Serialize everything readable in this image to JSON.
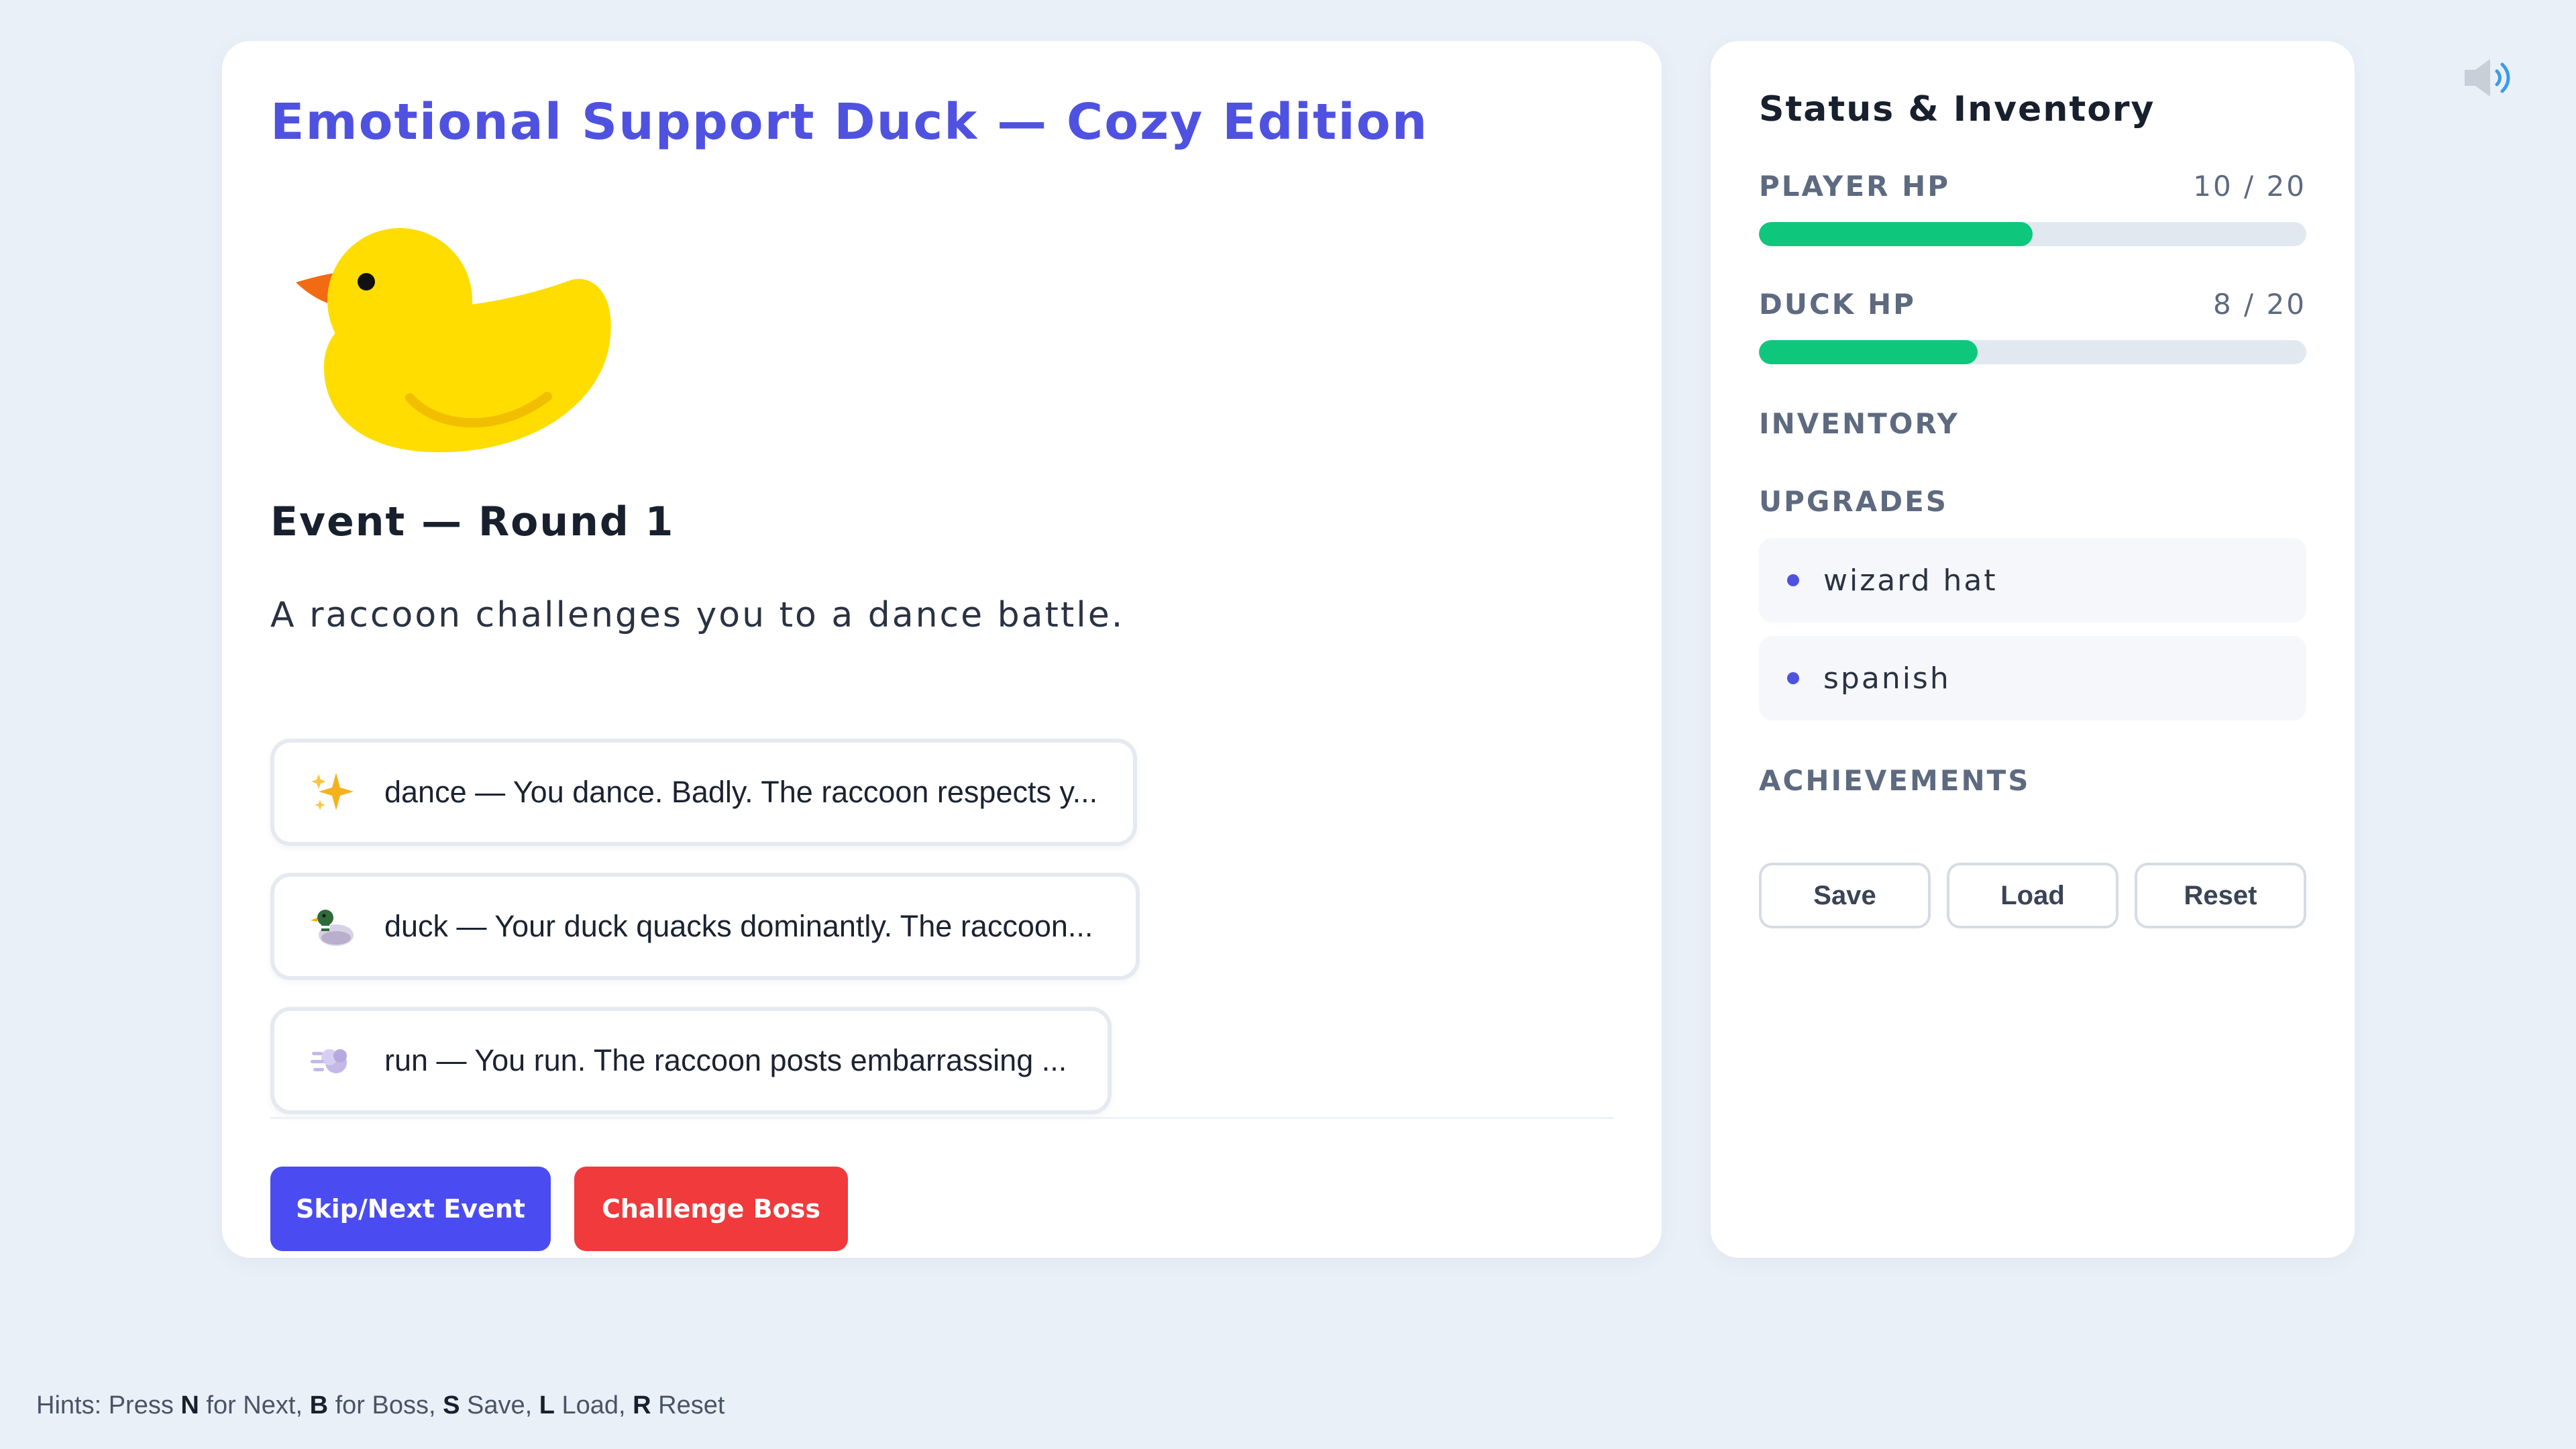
{
  "game": {
    "title": "Emotional Support Duck — Cozy Edition"
  },
  "event": {
    "heading": "Event — Round 1",
    "text": "A raccoon challenges you to a dance battle.",
    "choices": [
      {
        "icon": "sparkles-icon",
        "label": "dance — You dance. Badly. The raccoon respects y..."
      },
      {
        "icon": "duck-icon",
        "label": "duck — Your duck quacks dominantly. The raccoon..."
      },
      {
        "icon": "dash-icon",
        "label": "run — You run. The raccoon posts embarrassing ..."
      }
    ]
  },
  "actions": {
    "next_label": "Skip/Next Event",
    "boss_label": "Challenge Boss"
  },
  "status": {
    "title": "Status & Inventory",
    "player_hp": {
      "label": "PLAYER HP",
      "current": 10,
      "max": 20,
      "display": "10 / 20"
    },
    "duck_hp": {
      "label": "DUCK HP",
      "current": 8,
      "max": 20,
      "display": "8 / 20"
    },
    "inventory_label": "INVENTORY",
    "upgrades_label": "UPGRADES",
    "upgrades": [
      "wizard hat",
      "spanish"
    ],
    "achievements_label": "ACHIEVEMENTS",
    "save_label": "Save",
    "load_label": "Load",
    "reset_label": "Reset"
  },
  "hints": {
    "prefix": "Hints: Press ",
    "k1": "N",
    "t1": " for Next, ",
    "k2": "B",
    "t2": " for Boss, ",
    "k3": "S",
    "t3": " Save, ",
    "k4": "L",
    "t4": " Load, ",
    "k5": "R",
    "t5": " Reset"
  },
  "colors": {
    "accent": "#4f52e0",
    "primary_button": "#4a4cf2",
    "danger_button": "#f03a3c",
    "hp_bar": "#0fc77c",
    "duck_body": "#ffdd00",
    "duck_beak": "#f26a12"
  }
}
